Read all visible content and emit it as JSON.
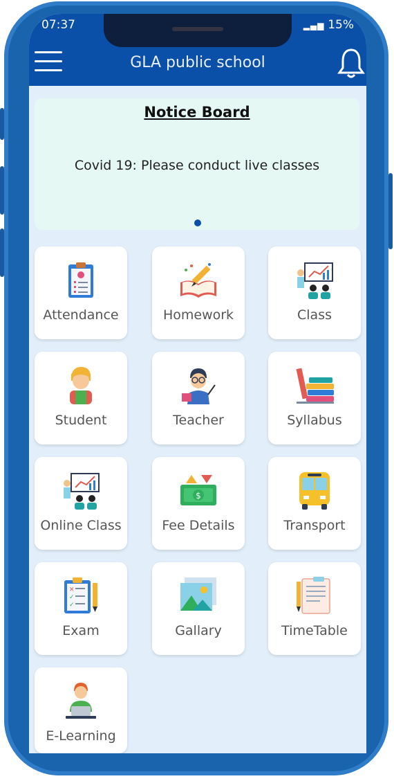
{
  "status": {
    "time": "07:37",
    "battery": "15%"
  },
  "header": {
    "title": "GLA public school"
  },
  "notice": {
    "title": "Notice Board",
    "message": "Covid 19: Please conduct live classes"
  },
  "tiles": [
    {
      "label": "Attendance",
      "icon": "clipboard-icon"
    },
    {
      "label": "Homework",
      "icon": "book-pencil-icon"
    },
    {
      "label": "Class",
      "icon": "classroom-icon"
    },
    {
      "label": "Student",
      "icon": "student-icon"
    },
    {
      "label": "Teacher",
      "icon": "teacher-icon"
    },
    {
      "label": "Syllabus",
      "icon": "books-stack-icon"
    },
    {
      "label": "Online Class",
      "icon": "online-class-icon"
    },
    {
      "label": "Fee Details",
      "icon": "money-icon"
    },
    {
      "label": "Transport",
      "icon": "bus-icon"
    },
    {
      "label": "Exam",
      "icon": "exam-checklist-icon"
    },
    {
      "label": "Gallary",
      "icon": "gallery-image-icon"
    },
    {
      "label": "TimeTable",
      "icon": "timetable-notepad-icon"
    },
    {
      "label": "E-Learning",
      "icon": "e-learning-laptop-icon"
    }
  ],
  "colors": {
    "primary": "#0a4fa8",
    "frame": "#1a63ad",
    "background": "#e2effb",
    "notice_bg": "#e6f8f3"
  }
}
